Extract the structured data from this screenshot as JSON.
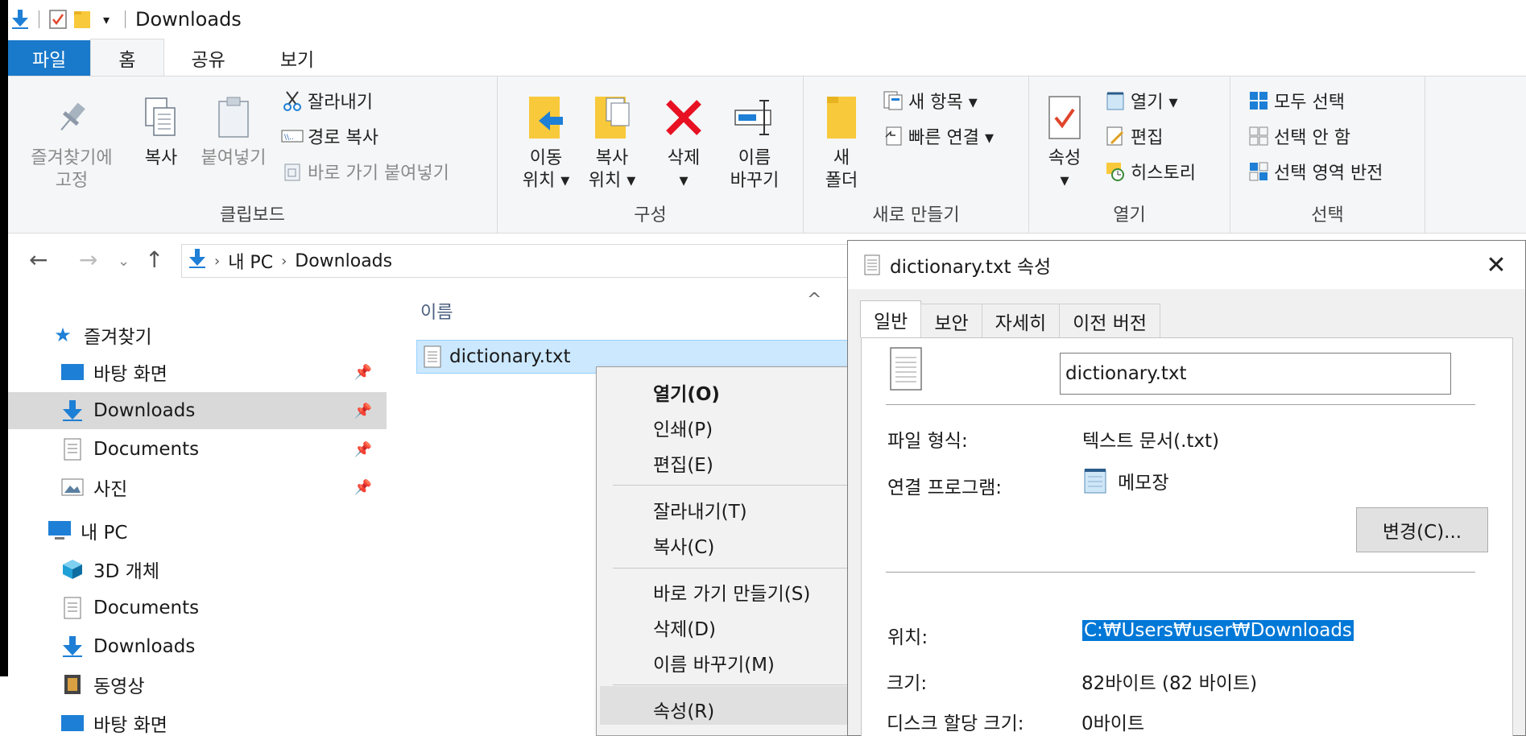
{
  "window": {
    "title": "Downloads"
  },
  "ribbon": {
    "tabs": [
      "파일",
      "홈",
      "공유",
      "보기"
    ],
    "clipboard": {
      "label": "클립보드",
      "pin": [
        "즐겨찾기에",
        "고정"
      ],
      "copy": "복사",
      "paste": "붙여넣기",
      "cut": "잘라내기",
      "copy_path": "경로 복사",
      "paste_shortcut": "바로 가기 붙여넣기"
    },
    "organize": {
      "label": "구성",
      "move_to": [
        "이동",
        "위치 ▾"
      ],
      "copy_to": [
        "복사",
        "위치 ▾"
      ],
      "delete": [
        "삭제",
        "▾"
      ],
      "rename": [
        "이름",
        "바꾸기"
      ]
    },
    "new": {
      "label": "새로 만들기",
      "new_folder": [
        "새",
        "폴더"
      ],
      "new_item": "새 항목 ▾",
      "easy_access": "빠른 연결 ▾"
    },
    "open": {
      "label": "열기",
      "properties": [
        "속성",
        "▾"
      ],
      "open": "열기 ▾",
      "edit": "편집",
      "history": "히스토리"
    },
    "select": {
      "label": "선택",
      "select_all": "모두 선택",
      "select_none": "선택 안 함",
      "invert": "선택 영역 반전"
    }
  },
  "address": {
    "crumbs": [
      "내 PC",
      "Downloads"
    ]
  },
  "navpane": {
    "quick_access": "즐겨찾기",
    "items": [
      {
        "label": "바탕 화면"
      },
      {
        "label": "Downloads"
      },
      {
        "label": "Documents"
      },
      {
        "label": "사진"
      }
    ],
    "this_pc": "내 PC",
    "pc_items": [
      {
        "label": "3D 개체"
      },
      {
        "label": "Documents"
      },
      {
        "label": "Downloads"
      },
      {
        "label": "동영상"
      },
      {
        "label": "바탕 화면"
      }
    ]
  },
  "filelist": {
    "column_name": "이름",
    "files": [
      {
        "name": "dictionary.txt"
      }
    ]
  },
  "context_menu": {
    "items": [
      "열기(O)",
      "인쇄(P)",
      "편집(E)",
      "잘라내기(T)",
      "복사(C)",
      "바로 가기 만들기(S)",
      "삭제(D)",
      "이름 바꾸기(M)",
      "속성(R)"
    ]
  },
  "properties": {
    "title": "dictionary.txt 속성",
    "tabs": [
      "일반",
      "보안",
      "자세히",
      "이전 버전"
    ],
    "filename": "dictionary.txt",
    "file_type_label": "파일 형식:",
    "file_type_value": "텍스트 문서(.txt)",
    "opens_with_label": "연결 프로그램:",
    "opens_with_value": "메모장",
    "change_button": "변경(C)...",
    "location_label": "위치:",
    "location_value": "C:₩Users₩user₩Downloads",
    "size_label": "크기:",
    "size_value": "82바이트 (82 바이트)",
    "size_on_disk_label": "디스크 할당 크기:",
    "size_on_disk_value": "0바이트"
  },
  "colors": {
    "file_tab": "#1979ca",
    "selection": "#cce8ff",
    "highlight": "#0078d7",
    "delete_red": "#e81123",
    "folder_yellow": "#f8c93b"
  }
}
